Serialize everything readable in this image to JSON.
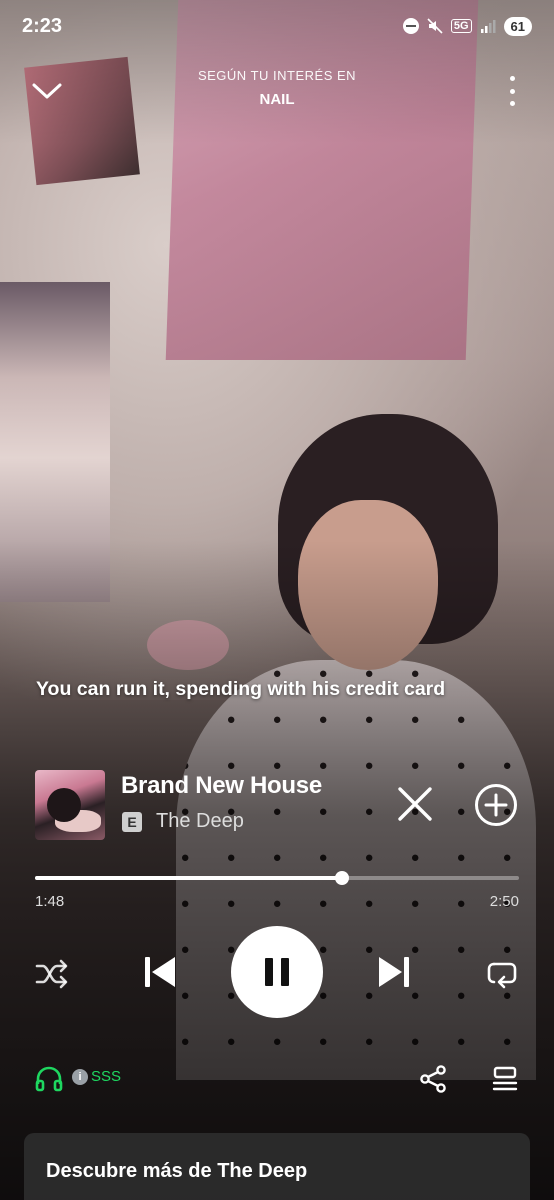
{
  "status_bar": {
    "time": "2:23",
    "network": "5G",
    "battery": "61"
  },
  "header": {
    "context_label": "SEGÚN TU INTERÉS EN",
    "context_name": "NAIL"
  },
  "lyric_line": "You can run it, spending with his credit card",
  "track": {
    "title": "Brand New House",
    "explicit_badge": "E",
    "artist": "The Deep"
  },
  "playback": {
    "elapsed": "1:48",
    "duration": "2:50",
    "progress_fraction": 0.635
  },
  "device": {
    "label": "SSS",
    "info_glyph": "i",
    "color": "#1ed760"
  },
  "discover": {
    "title": "Descubre más de The Deep"
  },
  "icons": {
    "collapse": "chevron-down-icon",
    "more": "more-vertical-icon",
    "remove": "close-icon",
    "add": "plus-circle-icon",
    "shuffle": "shuffle-icon",
    "previous": "skip-previous-icon",
    "pause": "pause-icon",
    "next": "skip-next-icon",
    "repeat": "repeat-icon",
    "devices": "headphones-icon",
    "share": "share-icon",
    "queue": "queue-icon"
  }
}
